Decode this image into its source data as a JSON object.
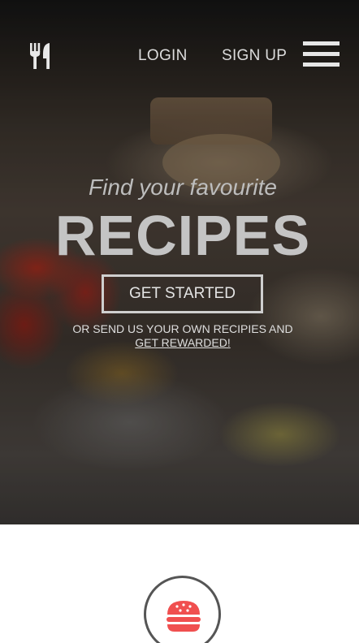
{
  "header": {
    "logo_icon": "fork-knife-icon",
    "nav": {
      "login": "LOGIN",
      "signup": "SIGN UP"
    },
    "menu_icon": "hamburger-menu-icon"
  },
  "hero": {
    "tagline": "Find your favourite",
    "headline": "RECIPES",
    "cta_label": "GET STARTED",
    "subtext": "OR SEND US YOUR OWN RECIPIES AND",
    "subtext_link": "GET REWARDED!"
  },
  "feature": {
    "icon": "burger-icon",
    "accent_color": "#f04f4f"
  },
  "colors": {
    "hero_text": "#c4c4c4",
    "badge_border": "#555555",
    "background": "#ffffff"
  }
}
